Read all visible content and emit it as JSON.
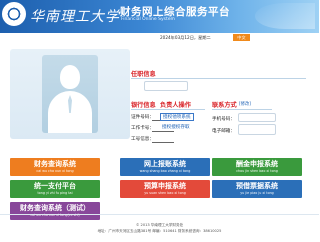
{
  "header": {
    "school_name": "华南理工大学",
    "system_title": "财务网上综合服务平台",
    "system_subtitle": "Financial Online System"
  },
  "topbar": {
    "date_text": "2024年03月12日，星期二",
    "lang_label": "中文"
  },
  "profile": {
    "section_personal": "任职信息",
    "section_bank": "银行信息",
    "bank_fields": [
      "证件号码：",
      "工作卡号：",
      "工号信息："
    ]
  },
  "responsible": {
    "title": "负责人操作",
    "links": [
      "授权他项系统",
      "授权授权存取"
    ]
  },
  "contact": {
    "title": "联系方式",
    "edit_label": "[修改]",
    "fields": [
      "手机号码：",
      "电子邮箱："
    ]
  },
  "tiles": [
    {
      "label": "财务查询系统",
      "sub": "cai wu cha xun xi tong",
      "color": "#ee7d1f"
    },
    {
      "label": "网上报账系统",
      "sub": "wang shang bao zhang xi tong",
      "color": "#2b6fb8"
    },
    {
      "label": "酬金申报系统",
      "sub": "chou jin shen bao xi tong",
      "color": "#3a9a3d"
    },
    {
      "label": "统一支付平台",
      "sub": "tong yi zhi fu ping tai",
      "color": "#3a9a3d"
    },
    {
      "label": "预算申报系统",
      "sub": "yu suan shen bao xi tong",
      "color": "#e34a3a"
    },
    {
      "label": "预借票据系统",
      "sub": "yu jie piao ju xi tong",
      "color": "#2b6fb8"
    },
    {
      "label": "财务查询系统（测试）",
      "sub": "cai wu cha xun xi tong(ce shi)",
      "color": "#88479a"
    }
  ],
  "footer": {
    "copyright": "© 2013 华南理工大学财务处",
    "address": "地址：广州市天河区五山路381号 邮编：510641 财务系统咨询：38610025"
  }
}
